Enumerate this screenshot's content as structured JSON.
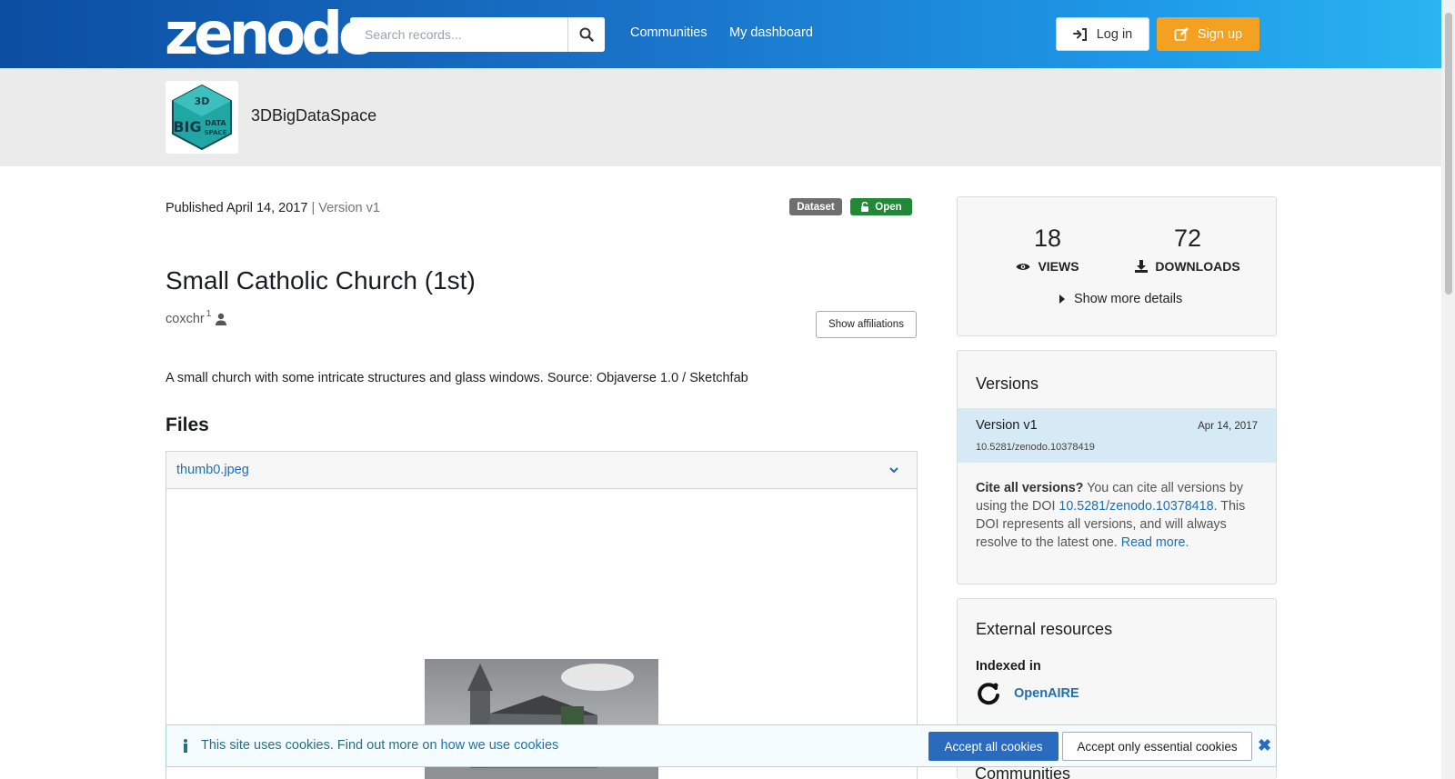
{
  "header": {
    "logo": "zenodo",
    "search_placeholder": "Search records...",
    "nav": [
      "Communities",
      "My dashboard"
    ],
    "login_label": "Log in",
    "signup_label": "Sign up"
  },
  "community": {
    "name": "3DBigDataSpace",
    "logo_lines": [
      "3D",
      "BIG",
      "DATA",
      "SPACE"
    ]
  },
  "record": {
    "published": "Published April 14, 2017",
    "version_sep": "| Version v1",
    "badge_type": "Dataset",
    "badge_access": "Open",
    "title": "Small Catholic Church (1st)",
    "creator": "coxchr",
    "creator_affil_num": "1",
    "affiliations_button": "Show affiliations",
    "description": "A small church with some intricate structures and glass windows. Source: Objaverse 1.0 / Sketchfab"
  },
  "files": {
    "heading": "Files",
    "file_name": "thumb0.jpeg"
  },
  "stats": {
    "views": "18",
    "views_label": "VIEWS",
    "downloads": "72",
    "downloads_label": "DOWNLOADS",
    "more_details": "Show more details"
  },
  "versions": {
    "title": "Versions",
    "current": {
      "name": "Version v1",
      "date": "Apr 14, 2017",
      "doi": "10.5281/zenodo.10378419"
    },
    "cite_bold": "Cite all versions?",
    "cite_text1": " You can cite all versions by using the DOI ",
    "cite_doi": "10.5281/zenodo.10378418",
    "cite_text2": ". This DOI represents all versions, and will always resolve to the latest one. ",
    "read_more": "Read more."
  },
  "external": {
    "title": "External resources",
    "indexed_in": "Indexed in",
    "source": "OpenAIRE"
  },
  "communities_title": "Communities",
  "cookie": {
    "text": "This site uses cookies. Find out more on ",
    "link": "how we use cookies",
    "accept_all": "Accept all cookies",
    "accept_essential": "Accept only essential cookies",
    "close": "✖"
  },
  "colors": {
    "header_start": "#0b4ea2",
    "header_end": "#2ab4f0",
    "signup": "#f4a020",
    "open_badge": "#218838",
    "link": "#1f6fb2"
  }
}
